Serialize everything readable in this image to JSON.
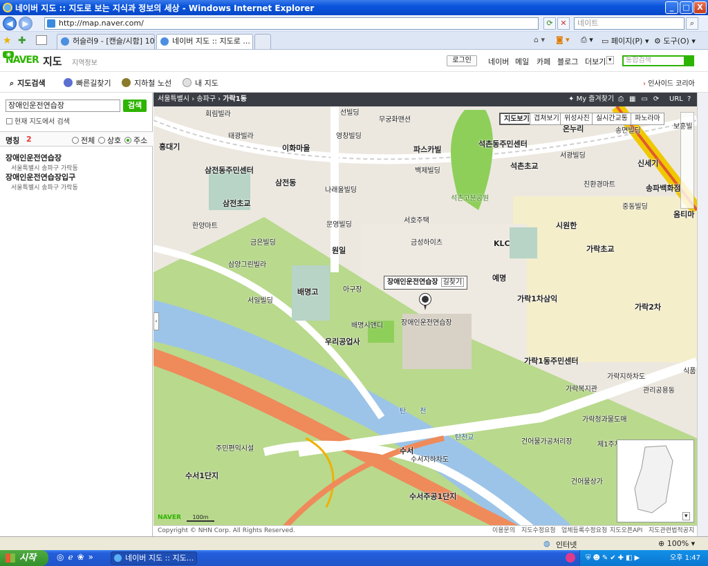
{
  "window": {
    "title": "네이버 지도 :: 지도로 보는 지식과 정보의 세상 - Windows Internet Explorer",
    "min": "_",
    "max": "□",
    "close": "X"
  },
  "address": {
    "url": "http://map.naver.com/",
    "search_placeholder": "네이트"
  },
  "tabs": [
    {
      "label": "허슬러9 - [캔슬/시함] 10..."
    },
    {
      "label": "네이버 지도 :: 지도로 ..."
    }
  ],
  "toolbar": {
    "page": "페이지(P)",
    "tools": "도구(O)"
  },
  "naver": {
    "logo": "NAVER",
    "title": "지도",
    "subtitle": "지역정보",
    "login": "로그인",
    "links": [
      "네이버",
      "메일",
      "카페",
      "블로그",
      "더보기"
    ],
    "search_placeholder": "통합검색"
  },
  "menu": {
    "items": [
      "지도검색",
      "빠른길찾기",
      "지하철 노선",
      "내 지도"
    ],
    "inside": "인사이드 코리아"
  },
  "left": {
    "query": "장애인운전연습장",
    "search_btn": "검색",
    "within_map": "현재 지도에서 검색",
    "filter_label": "명칭",
    "filter_count": "2",
    "radios": [
      "전체",
      "상호",
      "주소"
    ],
    "results": [
      {
        "title": "장애인운전연습장",
        "addr": "서울특별시 송파구 가락동"
      },
      {
        "title": "장애인운전연습장입구",
        "addr": "서울특별시 송파구 가락동"
      }
    ]
  },
  "map": {
    "breadcrumb": [
      "서울특별시",
      "송파구",
      "가락1동"
    ],
    "my_loc": "My 즐겨찾기",
    "types": [
      "지도보기",
      "겹쳐보기",
      "위성사진",
      "실시간교통",
      "파노라마"
    ],
    "callout": "장애인운전연습장",
    "callout_btn": "길찾기",
    "labels": {
      "a1": "회림빌라",
      "a2": "선빌딩",
      "a3": "무궁화맨션",
      "a4": "태광빌라",
      "a5": "영창빌딩",
      "a6": "흥대기",
      "a7": "이화마을",
      "a8": "파스카빌",
      "a9": "석촌동주민센터",
      "a10": "온누리",
      "a11": "송면빌딩",
      "a12": "서광빌딩",
      "a13": "삼전동주민센터",
      "a14": "삼전동",
      "a15": "백제빌딩",
      "a16": "석촌초교",
      "a17": "신세기",
      "a18": "나래울빌딩",
      "a19": "친환경마트",
      "a20": "송파백화점",
      "a21": "삼전초교",
      "a22": "석촌고분공원",
      "a23": "중동빌딩",
      "a24": "한양마트",
      "a25": "서호주택",
      "a26": "문영빌딩",
      "a27": "시원한",
      "a28": "옴티마",
      "a29": "금은빌딩",
      "a30": "금성하이츠",
      "a31": "원일",
      "a32": "KLC",
      "a33": "가락초교",
      "a34": "삼양그린빌라",
      "a35": "예명",
      "a36": "아구장",
      "a37": "가락1차삼익",
      "a38": "서일빌딩",
      "a39": "배명고",
      "a40": "가락2차",
      "a41": "배명시앤디",
      "a42": "장애인운전연습장",
      "a43": "우리공업사",
      "a44": "가락1동주민센터",
      "a45": "가락지하차도",
      "a46": "식품",
      "a47": "가락복지관",
      "a48": "관리공용동",
      "a49": "탄천",
      "a50": "가락청과물도매",
      "a51": "탄천교",
      "a52": "건어물가공처리장",
      "a53": "제1주차",
      "a54": "주민편익시설",
      "a55": "수서",
      "a56": "수서지하차도",
      "a57": "건어물상가",
      "a58": "수서1단지",
      "a59": "수서주공1단지",
      "a60": "보훈빌"
    },
    "scale": "100m",
    "naver_logo": "NAVER",
    "footer": {
      "copy": "Copyright © NHN Corp. All Rights Reserved.",
      "links": [
        "이용문의",
        "지도수정요청",
        "업체등록수정요청",
        "지도오픈API",
        "지도관련법적공지"
      ]
    }
  },
  "status": {
    "zone": "인터넷",
    "zoom": "100%"
  },
  "taskbar": {
    "start": "시작",
    "task": "네이버 지도 :: 지도...",
    "clock": "오후 1:47"
  },
  "colors": {
    "naver_green": "#2db400",
    "xp_blue": "#245edb"
  }
}
